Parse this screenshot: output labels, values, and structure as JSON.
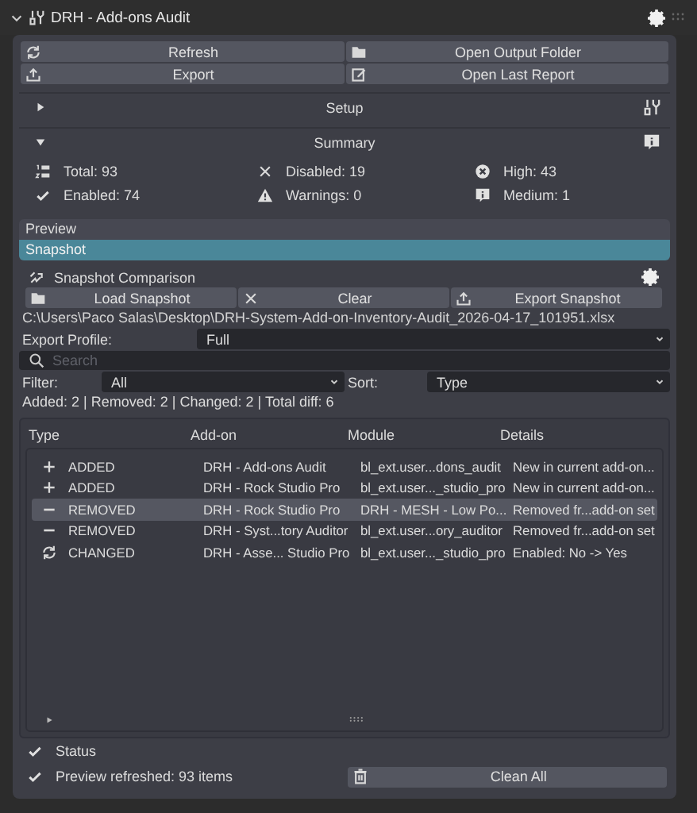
{
  "panel": {
    "title": "DRH - Add-ons Audit",
    "expanded": true
  },
  "actions": [
    {
      "label": "Refresh"
    },
    {
      "label": "Open Output Folder"
    },
    {
      "label": "Export"
    },
    {
      "label": "Open Last Report"
    }
  ],
  "sections": [
    {
      "label": "Setup",
      "expanded": false
    },
    {
      "label": "Summary",
      "expanded": true
    }
  ],
  "summary": [
    {
      "label": "Total: 93"
    },
    {
      "label": "Disabled: 19"
    },
    {
      "label": "High: 43"
    },
    {
      "label": "Enabled: 74"
    },
    {
      "label": "Warnings: 0"
    },
    {
      "label": "Medium: 1"
    }
  ],
  "views": [
    {
      "label": "Preview",
      "selected": false
    },
    {
      "label": "Snapshot",
      "selected": true
    }
  ],
  "snapshot": {
    "title": "Snapshot Comparison",
    "buttons": [
      {
        "label": "Load Snapshot"
      },
      {
        "label": "Clear"
      },
      {
        "label": "Export Snapshot"
      }
    ],
    "path": "C:\\Users\\Paco Salas\\Desktop\\DRH-System-Add-on-Inventory-Audit_2026-04-17_101951.xlsx",
    "export_profile": {
      "label": "Export Profile:",
      "value": "Full"
    },
    "search": {
      "placeholder": "Search"
    },
    "filter": {
      "label": "Filter:",
      "value": "All"
    },
    "sort": {
      "label": "Sort:",
      "value": "Type"
    },
    "totals": "Added: 2 | Removed: 2 | Changed: 2 | Total diff: 6"
  },
  "table": {
    "columns": [
      "Type",
      "Add-on",
      "Module",
      "Details"
    ],
    "rows": [
      {
        "kind": "added",
        "type": "ADDED",
        "addon": "DRH - Add-ons Audit",
        "module": "bl_ext.user...dons_audit",
        "details": "New in current add-on...",
        "selected": false
      },
      {
        "kind": "added",
        "type": "ADDED",
        "addon": "DRH - Rock Studio Pro",
        "module": "bl_ext.user..._studio_pro",
        "details": "New in current add-on...",
        "selected": false
      },
      {
        "kind": "removed",
        "type": "REMOVED",
        "addon": "DRH - Rock Studio Pro",
        "module": "DRH - MESH - Low Po...",
        "details": "Removed fr...add-on set",
        "selected": true
      },
      {
        "kind": "removed",
        "type": "REMOVED",
        "addon": "DRH - Syst...tory Auditor",
        "module": "bl_ext.user...ory_auditor",
        "details": "Removed fr...add-on set",
        "selected": false
      },
      {
        "kind": "changed",
        "type": "CHANGED",
        "addon": "DRH - Asse... Studio Pro",
        "module": "bl_ext.user..._studio_pro",
        "details": "Enabled: No -> Yes",
        "selected": false
      }
    ]
  },
  "status": {
    "title": "Status",
    "message": "Preview refreshed: 93 items",
    "button": "Clean All"
  }
}
